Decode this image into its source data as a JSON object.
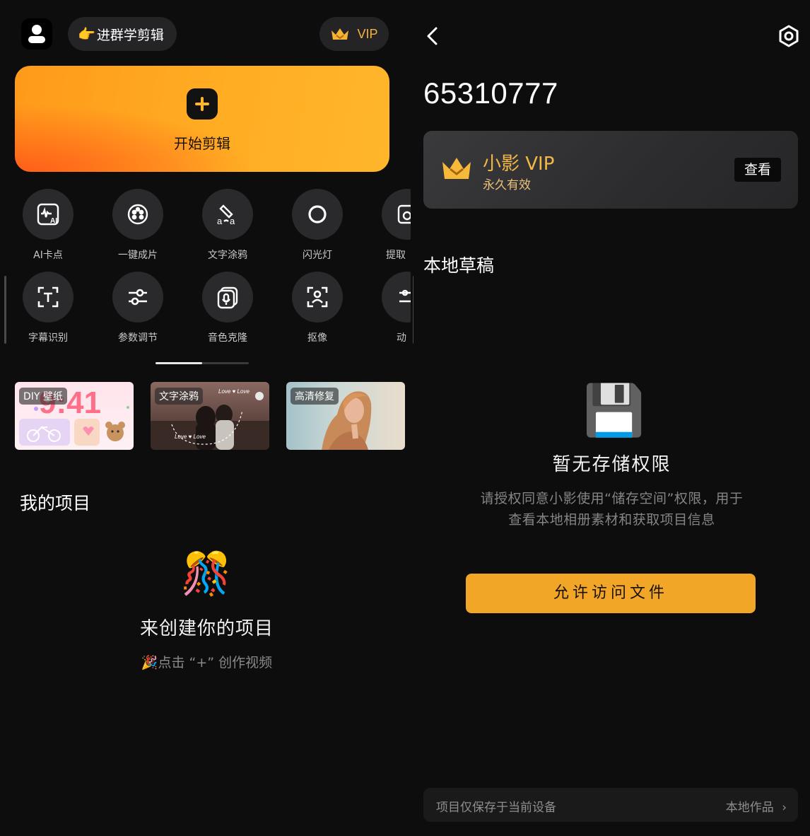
{
  "home": {
    "group_label": "进群学剪辑",
    "group_emoji": "👉",
    "vip_label": "VIP",
    "start_label": "开始剪辑",
    "tools_row1": [
      {
        "label": "AI卡点",
        "icon": "ai-waveform-icon"
      },
      {
        "label": "一键成片",
        "icon": "film-reel-icon"
      },
      {
        "label": "文字涂鸦",
        "icon": "text-doodle-icon"
      },
      {
        "label": "闪光灯",
        "icon": "flash-ring-icon"
      },
      {
        "label": "提取",
        "icon": "extract-icon"
      }
    ],
    "tools_row2": [
      {
        "label": "字幕识别",
        "icon": "subtitle-scan-icon"
      },
      {
        "label": "参数调节",
        "icon": "sliders-icon"
      },
      {
        "label": "音色克隆",
        "icon": "voice-clone-icon"
      },
      {
        "label": "抠像",
        "icon": "portrait-cutout-icon"
      },
      {
        "label": "动",
        "icon": "motion-icon"
      }
    ],
    "promos": [
      {
        "tag": "DIY 壁纸",
        "big_text": "9:41"
      },
      {
        "tag": "文字涂鸦"
      },
      {
        "tag": "高清修复"
      }
    ],
    "projects_title": "我的项目",
    "empty_emoji": "🎊",
    "empty_title": "来创建你的项目",
    "empty_hint_emoji": "🎉",
    "empty_hint": "点击 “+” 创作视频"
  },
  "profile": {
    "user_id": "65310777",
    "vip_name": "小影 VIP",
    "vip_validity": "永久有效",
    "view_label": "查看",
    "drafts_title": "本地草稿",
    "storage_emoji": "💾",
    "no_permission_title": "暂无存储权限",
    "permission_desc_line1": "请授权同意小影使用“储存空间”权限，用于",
    "permission_desc_line2": "查看本地相册素材和获取项目信息",
    "allow_label": "允许访问文件",
    "footer_note": "项目仅保存于当前设备",
    "footer_link": "本地作品",
    "footer_chevron": "›"
  },
  "colors": {
    "accent_orange": "#f1a628",
    "vip_gold": "#f5b844",
    "background": "#0d0d0e"
  }
}
